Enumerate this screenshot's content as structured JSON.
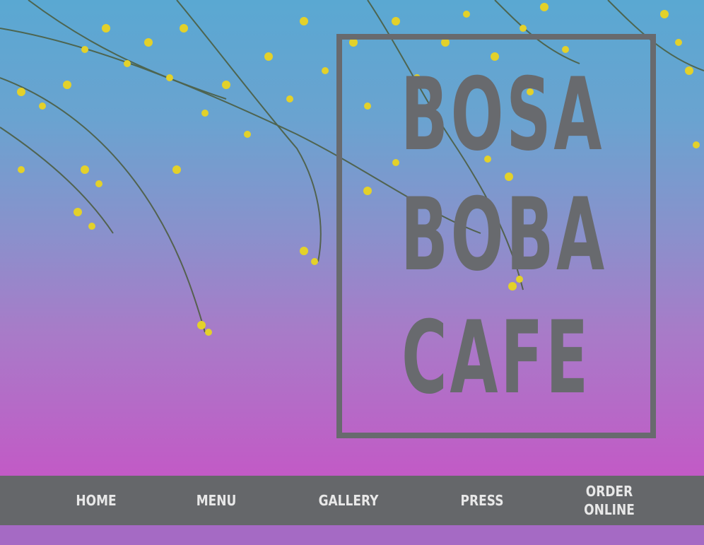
{
  "logo": {
    "line1": "BOSA",
    "line2": "BOBA",
    "line3": "CAFE"
  },
  "nav": {
    "items": [
      {
        "label": "HOME"
      },
      {
        "label": "MENU"
      },
      {
        "label": "GALLERY"
      },
      {
        "label": "PRESS"
      },
      {
        "label_line1": "ORDER",
        "label_line2": "ONLINE"
      }
    ]
  },
  "colors": {
    "nav_background": "#65676a",
    "nav_text": "#e8e8e8",
    "logo": "#686a6e",
    "sky_top": "#5aa8d2",
    "sky_bottom": "#c25ac6",
    "footer_strip": "#a56ac4"
  }
}
